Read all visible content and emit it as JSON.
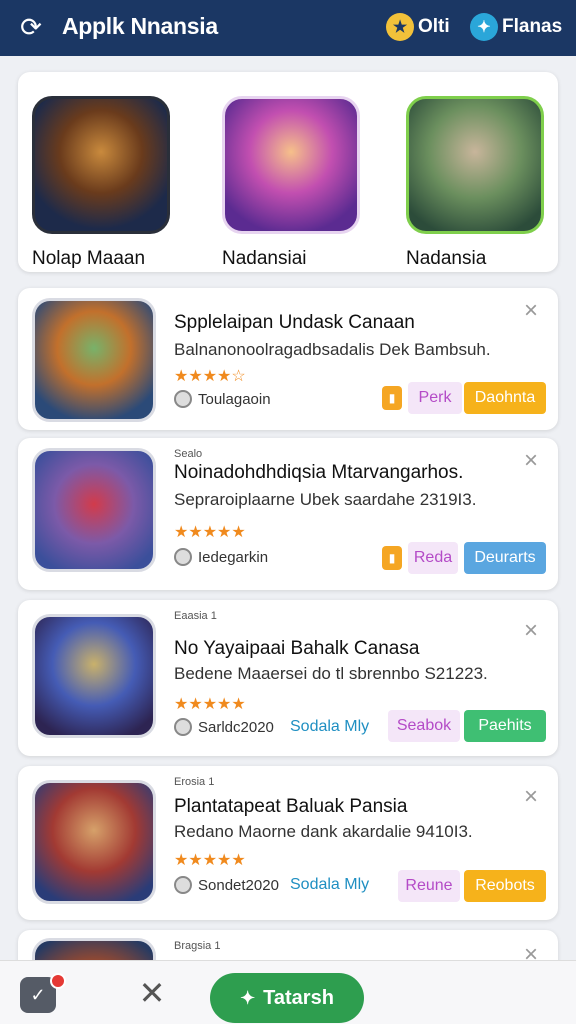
{
  "app": {
    "title": "Applk Nnansia",
    "refresh_icon": "refresh-icon",
    "actions": [
      {
        "label": "Olti",
        "icon": "star-icon"
      },
      {
        "label": "Flanas",
        "icon": "twitter-bird-icon"
      }
    ]
  },
  "featured": [
    {
      "name": "Nolap Maaan",
      "icon": "game-art-warrior"
    },
    {
      "name": "Nadansiai",
      "icon": "game-art-heroine"
    },
    {
      "name": "Nadansia",
      "icon": "game-art-soldier"
    }
  ],
  "cards": [
    {
      "category": "",
      "title": "Spplelaipan Undask Canaan",
      "subtitle": "Balnanonoolragadbsadalis Dek Bambsuh.",
      "stars": "★★★★☆",
      "meta": "Toulagaoin",
      "link": "",
      "btn_a": "Perk",
      "btn_b": "Daohnta",
      "btn_b_color": "#f6b21b",
      "has_badge": true
    },
    {
      "category": "Sealo",
      "title": "Noinadohdhdiqsia Mtarvangarhos.",
      "subtitle": "Sepraroiplaarne Ubek saardahe 2319I3.",
      "stars": "★★★★★",
      "meta": "Iedegarkin",
      "link": "",
      "btn_a": "Reda",
      "btn_b": "Deurarts",
      "btn_b_color": "#5aa6e0",
      "has_badge": true
    },
    {
      "category": "Eaasia 1",
      "title": "No Yayaipaai Bahalk Canasa",
      "subtitle": "Bedene Maaersei do tl sbrennbo S21223.",
      "stars": "★★★★★",
      "meta": "Sarldc2020",
      "link": "Sodala Mly",
      "btn_a": "Seabok",
      "btn_b": "Paehits",
      "btn_b_color": "#3fbf73",
      "has_badge": false
    },
    {
      "category": "Erosia 1",
      "title": "Plantatapeat Baluak Pansia",
      "subtitle": "Redano Maorne dank akardalie 9410I3.",
      "stars": "★★★★★",
      "meta": "Sondet2020",
      "link": "Sodala Mly",
      "btn_a": "Reune",
      "btn_b": "Reobots",
      "btn_b_color": "#f6b21b",
      "has_badge": false
    },
    {
      "category": "Bragsia 1",
      "title": "",
      "subtitle": "",
      "stars": "",
      "meta": "",
      "link": "",
      "btn_a": "",
      "btn_b": "",
      "btn_b_color": "#f6b21b",
      "has_badge": false
    }
  ],
  "bottom": {
    "inbox_icon": "inbox-check-icon",
    "close_icon": "close-x-icon",
    "cta_label": "Tatarsh",
    "cta_icon": "twitter-bird-icon"
  }
}
